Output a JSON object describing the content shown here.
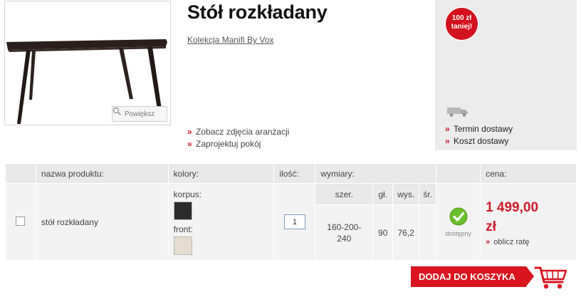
{
  "product": {
    "title": "Stół rozkładany",
    "collection_link": "Kolekcja Manifi By Vox",
    "zoom_label": "Powiększ",
    "links": [
      "Zobacz zdjęcia aranżacji",
      "Zaprojektuj pokój"
    ]
  },
  "promo": {
    "line1": "100 zł",
    "line2": "taniej!"
  },
  "delivery": {
    "links": [
      "Termin dostawy",
      "Koszt dostawy"
    ]
  },
  "table": {
    "headers": {
      "name": "nazwa produktu:",
      "colors": "kolory:",
      "qty": "ilość:",
      "dims": "wymiary:",
      "price": "cena:"
    },
    "dim_headers": {
      "width": "szer.",
      "depth": "gł.",
      "height": "wys.",
      "diameter": "śr."
    },
    "row": {
      "name": "stół rozkładany",
      "color_body_label": "korpus:",
      "color_front_label": "front:",
      "qty": "1",
      "width": "160-200-240",
      "width_line1": "160-200-",
      "width_line2": "240",
      "depth": "90",
      "height": "76,2",
      "diameter": "",
      "availability": "dostępny",
      "price_line1": "1 499,00",
      "price_line2": "zł",
      "installment_link": "oblicz ratę"
    }
  },
  "cart": {
    "add_label": "DODAJ DO KOSZYKA"
  },
  "colors": {
    "accent_red": "#d8151f",
    "swatch_body": "#2b2b2b",
    "swatch_front": "#e3dccf",
    "available_green": "#6cbf2c"
  }
}
